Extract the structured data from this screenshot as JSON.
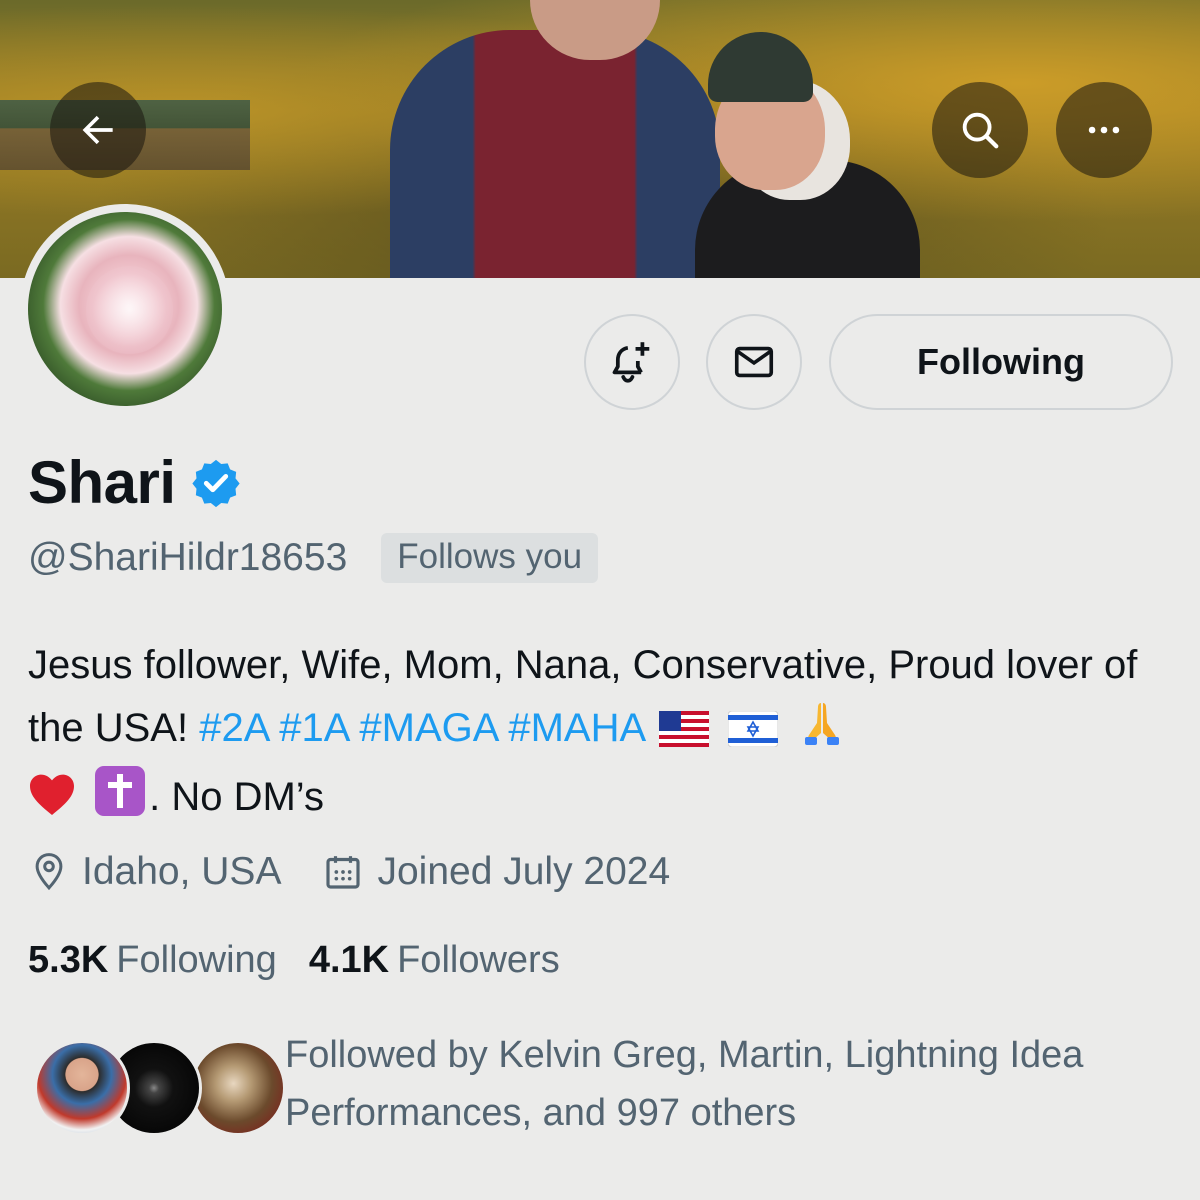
{
  "header": {
    "back_icon": "arrow-left-icon",
    "search_icon": "search-icon",
    "more_icon": "more-horizontal-icon"
  },
  "actions": {
    "notify_icon": "bell-plus-icon",
    "message_icon": "envelope-icon",
    "follow_label": "Following"
  },
  "profile": {
    "name": "Shari",
    "verified": true,
    "handle": "@ShariHildr18653",
    "follows_you_badge": "Follows you",
    "bio_text": "Jesus follower, Wife, Mom, Nana, Conservative, Proud lover of the USA!",
    "hashtags": [
      "#2A",
      "#1A",
      "#MAGA",
      "#MAHA"
    ],
    "bio_emojis": [
      "us-flag",
      "israel-flag",
      "praying-hands"
    ],
    "bio_emojis_line3": [
      "red-heart",
      "latin-cross"
    ],
    "bio_tail": ". No DM’s",
    "location": "Idaho, USA",
    "joined": "Joined July 2024"
  },
  "stats": {
    "following_count": "5.3K",
    "following_label": "Following",
    "followers_count": "4.1K",
    "followers_label": "Followers"
  },
  "followed_by": {
    "text": "Followed by Kelvin Greg, Martin, Lightning Idea Performances, and 997 others"
  },
  "colors": {
    "accent": "#1d9bf0",
    "background": "#ebebea",
    "muted_text": "#536471",
    "primary_text": "#0f1419"
  }
}
